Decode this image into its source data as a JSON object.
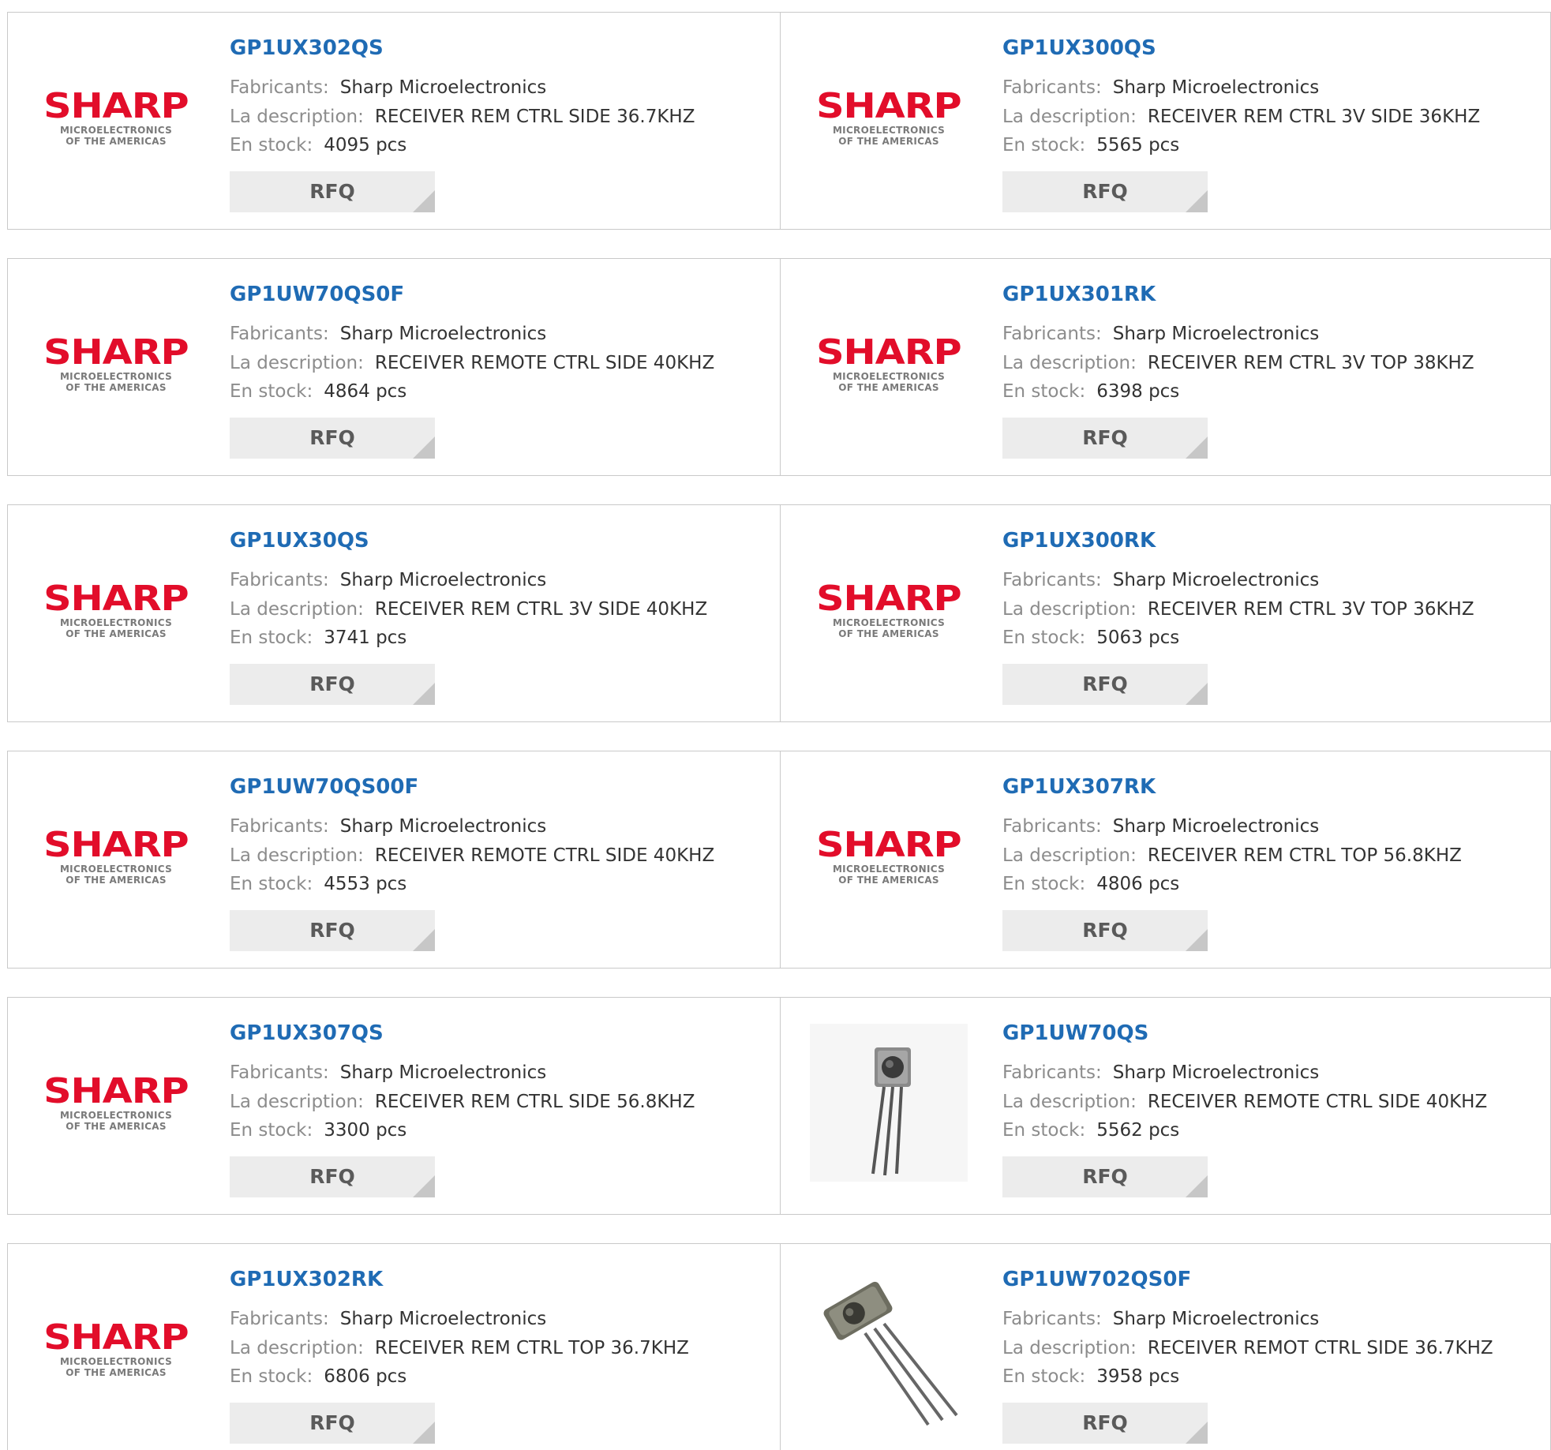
{
  "labels": {
    "manufacturer": "Fabricants:",
    "description": "La description:",
    "stock": "En stock:",
    "rfq": "RFQ"
  },
  "logo": {
    "brand": "SHARP",
    "tagline1": "MICROELECTRONICS",
    "tagline2": "OF THE AMERICAS"
  },
  "colors": {
    "part_link": "#1f6bb4",
    "brand_red": "#e20d2a",
    "label_gray": "#8c8c8c"
  },
  "products": [
    {
      "part": "GP1UX302QS",
      "manufacturer": "Sharp Microelectronics",
      "description": "RECEIVER REM CTRL SIDE 36.7KHZ",
      "stock": "4095 pcs",
      "image": "sharp-logo"
    },
    {
      "part": "GP1UX300QS",
      "manufacturer": "Sharp Microelectronics",
      "description": "RECEIVER REM CTRL 3V SIDE 36KHZ",
      "stock": "5565 pcs",
      "image": "sharp-logo"
    },
    {
      "part": "GP1UW70QS0F",
      "manufacturer": "Sharp Microelectronics",
      "description": "RECEIVER REMOTE CTRL SIDE 40KHZ",
      "stock": "4864 pcs",
      "image": "sharp-logo"
    },
    {
      "part": "GP1UX301RK",
      "manufacturer": "Sharp Microelectronics",
      "description": "RECEIVER REM CTRL 3V TOP 38KHZ",
      "stock": "6398 pcs",
      "image": "sharp-logo"
    },
    {
      "part": "GP1UX30QS",
      "manufacturer": "Sharp Microelectronics",
      "description": "RECEIVER REM CTRL 3V SIDE 40KHZ",
      "stock": "3741 pcs",
      "image": "sharp-logo"
    },
    {
      "part": "GP1UX300RK",
      "manufacturer": "Sharp Microelectronics",
      "description": "RECEIVER REM CTRL 3V TOP 36KHZ",
      "stock": "5063 pcs",
      "image": "sharp-logo"
    },
    {
      "part": "GP1UW70QS00F",
      "manufacturer": "Sharp Microelectronics",
      "description": "RECEIVER REMOTE CTRL SIDE 40KHZ",
      "stock": "4553 pcs",
      "image": "sharp-logo"
    },
    {
      "part": "GP1UX307RK",
      "manufacturer": "Sharp Microelectronics",
      "description": "RECEIVER REM CTRL TOP 56.8KHZ",
      "stock": "4806 pcs",
      "image": "sharp-logo"
    },
    {
      "part": "GP1UX307QS",
      "manufacturer": "Sharp Microelectronics",
      "description": "RECEIVER REM CTRL SIDE 56.8KHZ",
      "stock": "3300 pcs",
      "image": "sharp-logo"
    },
    {
      "part": "GP1UW70QS",
      "manufacturer": "Sharp Microelectronics",
      "description": "RECEIVER REMOTE CTRL SIDE 40KHZ",
      "stock": "5562 pcs",
      "image": "ir-receiver-photo-upright"
    },
    {
      "part": "GP1UX302RK",
      "manufacturer": "Sharp Microelectronics",
      "description": "RECEIVER REM CTRL TOP 36.7KHZ",
      "stock": "6806 pcs",
      "image": "sharp-logo"
    },
    {
      "part": "GP1UW702QS0F",
      "manufacturer": "Sharp Microelectronics",
      "description": "RECEIVER REMOT CTRL SIDE 36.7KHZ",
      "stock": "3958 pcs",
      "image": "ir-receiver-photo-tilted"
    }
  ]
}
